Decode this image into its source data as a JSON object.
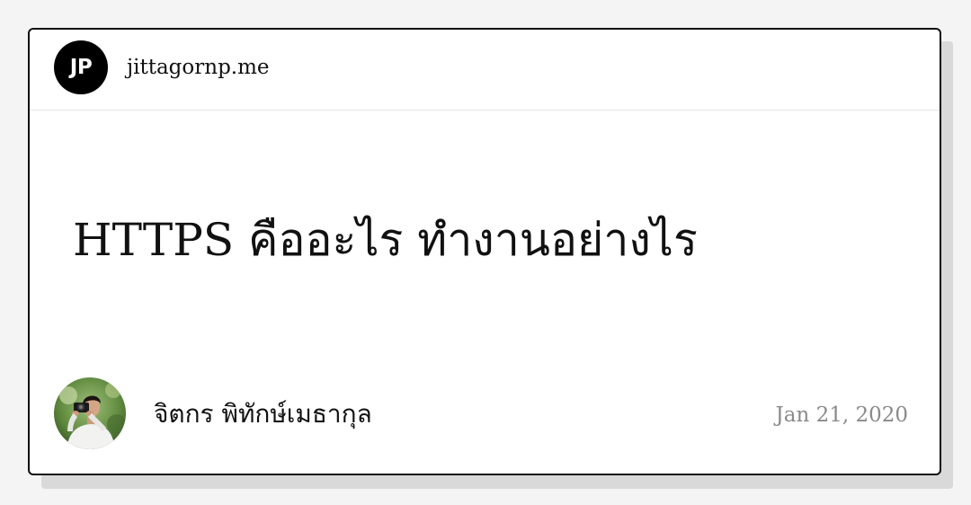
{
  "header": {
    "logo_text": "JP",
    "domain": "jittagornp.me"
  },
  "post": {
    "title": "HTTPS คืออะไร ทำงานอย่างไร",
    "author_name": "จิตกร พิทักษ์เมธากุล",
    "date": "Jan 21, 2020"
  },
  "colors": {
    "page_background": "#f4f4f4",
    "card_background": "#ffffff",
    "card_border": "#111111",
    "shadow": "#d9d9d9",
    "logo_background": "#000000",
    "date_text": "#8a8a8a"
  },
  "icons": {
    "logo": "jp-logo-icon",
    "avatar": "author-avatar-photo"
  }
}
